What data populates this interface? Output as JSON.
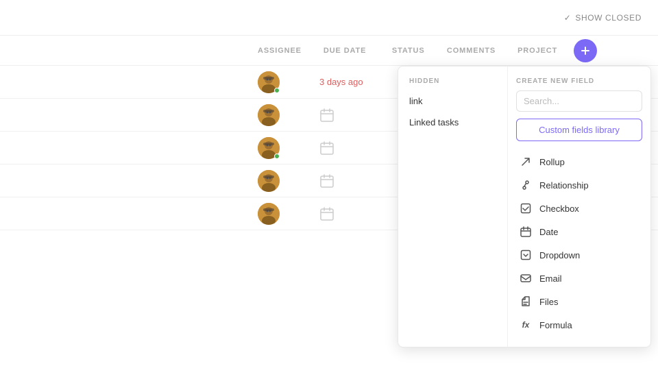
{
  "topbar": {
    "show_closed_label": "SHOW CLOSED"
  },
  "table": {
    "columns": [
      {
        "id": "assignee",
        "label": "ASSIGNEE"
      },
      {
        "id": "due_date",
        "label": "DUE DATE"
      },
      {
        "id": "status",
        "label": "STATUS"
      },
      {
        "id": "comments",
        "label": "COMMENTS"
      },
      {
        "id": "project",
        "label": "PROJECT"
      }
    ],
    "rows": [
      {
        "due_date": "3 days ago",
        "has_avatar": true,
        "has_status_dot": true
      },
      {
        "due_date": "",
        "has_avatar": true,
        "has_status_dot": false
      },
      {
        "due_date": "",
        "has_avatar": true,
        "has_status_dot": true
      },
      {
        "due_date": "",
        "has_avatar": true,
        "has_status_dot": false
      },
      {
        "due_date": "",
        "has_avatar": true,
        "has_status_dot": false
      }
    ]
  },
  "dropdown": {
    "hidden_section_label": "HIDDEN",
    "hidden_items": [
      {
        "id": "link",
        "label": "link"
      },
      {
        "id": "linked_tasks",
        "label": "Linked tasks"
      }
    ],
    "create_section_label": "CREATE NEW FIELD",
    "search_placeholder": "Search...",
    "library_button_label": "Custom fields library",
    "field_types": [
      {
        "id": "rollup",
        "label": "Rollup",
        "icon": "↗"
      },
      {
        "id": "relationship",
        "label": "Relationship",
        "icon": "🔗"
      },
      {
        "id": "checkbox",
        "label": "Checkbox",
        "icon": "☑"
      },
      {
        "id": "date",
        "label": "Date",
        "icon": "📅"
      },
      {
        "id": "dropdown",
        "label": "Dropdown",
        "icon": "⊟"
      },
      {
        "id": "email",
        "label": "Email",
        "icon": "✉"
      },
      {
        "id": "files",
        "label": "Files",
        "icon": "📎"
      },
      {
        "id": "formula",
        "label": "Formula",
        "icon": "fx"
      }
    ]
  },
  "colors": {
    "accent": "#7c6af7",
    "danger": "#e05c5c",
    "avatar_bg": "#c9913a"
  }
}
